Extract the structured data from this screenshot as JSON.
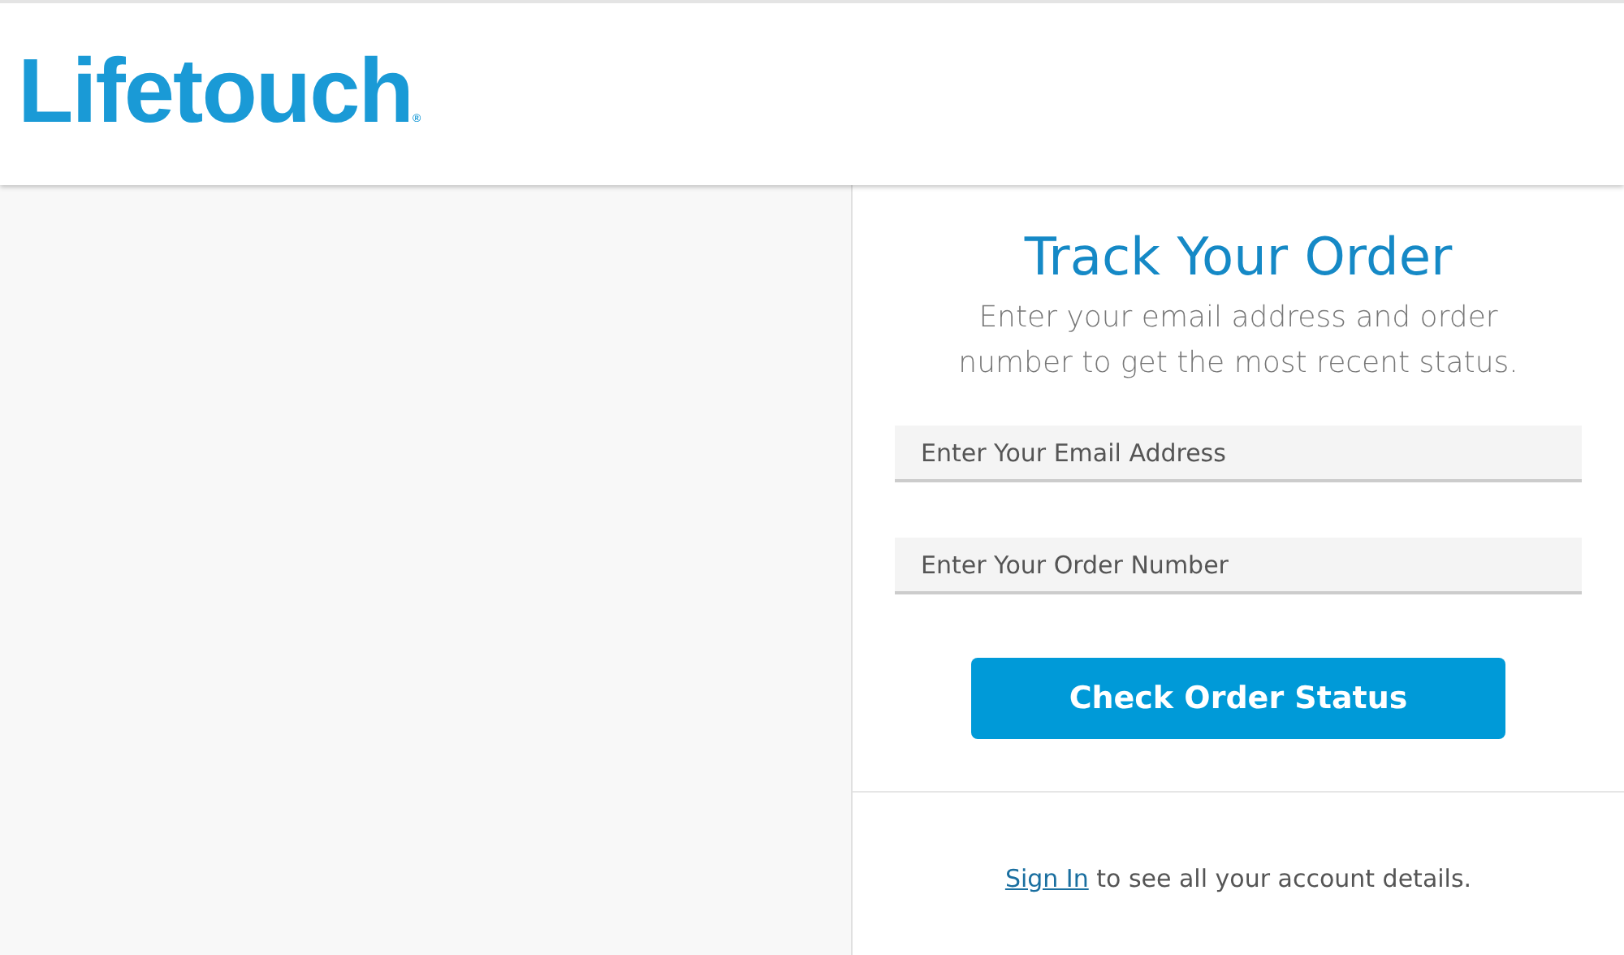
{
  "header": {
    "logo": "Lifetouch",
    "logo_mark": "®"
  },
  "track_panel": {
    "title": "Track Your Order",
    "subtitle": "Enter your email address and order number to get the most recent status.",
    "fields": [
      {
        "placeholder": "Enter Your Email Address"
      },
      {
        "placeholder": "Enter Your Order Number"
      }
    ],
    "button": "Check Order Status",
    "footer": {
      "link": "Sign In",
      "text": "to see all your account details."
    }
  }
}
